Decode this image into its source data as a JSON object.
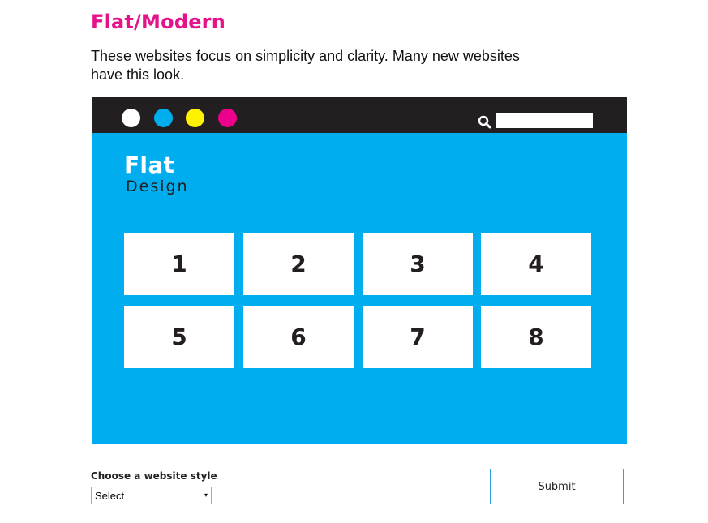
{
  "heading": {
    "text": "Flat/Modern",
    "color": "#e5138a"
  },
  "intro": {
    "text": "These websites focus on simplicity and clarity. Many new websites have this look."
  },
  "mockup": {
    "bar_color": "#231f20",
    "body_color": "#00adee",
    "window_dots": [
      {
        "name": "white-dot",
        "color": "#ffffff"
      },
      {
        "name": "cyan-dot",
        "color": "#00aeef"
      },
      {
        "name": "yellow-dot",
        "color": "#fff200"
      },
      {
        "name": "magenta-dot",
        "color": "#ec008c"
      }
    ],
    "search_icon": "magnifier-icon",
    "brand": {
      "line1": "Flat",
      "line2": "Design"
    },
    "tiles": [
      "1",
      "2",
      "3",
      "4",
      "5",
      "6",
      "7",
      "8"
    ]
  },
  "form": {
    "select_label": "Choose a website style",
    "select_value": "Select",
    "select_arrow": "▾",
    "submit_label": "Submit",
    "submit_border_color": "#2aa6e3"
  }
}
